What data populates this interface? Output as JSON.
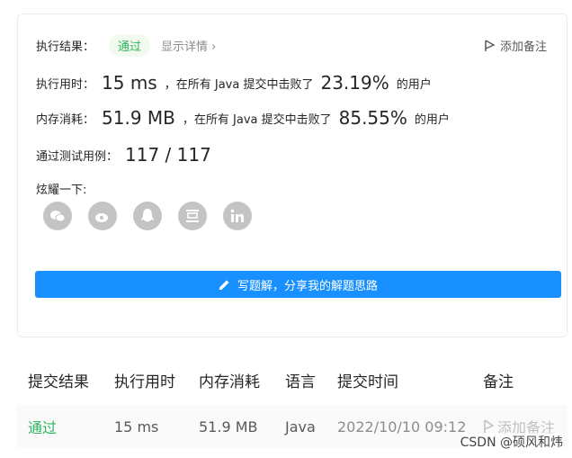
{
  "result": {
    "label": "执行结果：",
    "status": "通过",
    "detail": "显示详情 ›",
    "note": "添加备注"
  },
  "runtime": {
    "label": "执行用时：",
    "value": "15 ms",
    "mid": "，在所有 Java 提交中击败了",
    "percent": "23.19%",
    "suffix": "的用户"
  },
  "memory": {
    "label": "内存消耗：",
    "value": "51.9 MB",
    "mid": "，在所有 Java 提交中击败了",
    "percent": "85.55%",
    "suffix": "的用户"
  },
  "tests": {
    "label": "通过测试用例：",
    "value": "117 / 117"
  },
  "share": {
    "label": "炫耀一下:",
    "icons": [
      "wechat-icon",
      "weibo-icon",
      "qq-icon",
      "douban-icon",
      "linkedin-icon"
    ]
  },
  "solution_button": "写题解，分享我的解题思路",
  "table": {
    "headers": [
      "提交结果",
      "执行用时",
      "内存消耗",
      "语言",
      "提交时间",
      "备注"
    ],
    "row": {
      "status": "通过",
      "runtime": "15 ms",
      "memory": "51.9 MB",
      "language": "Java",
      "time": "2022/10/10 09:12",
      "note": "添加备注"
    }
  },
  "watermark": "CSDN @硕风和炜",
  "colors": {
    "accent": "#1890ff",
    "success": "#2db55d",
    "icon_gray": "#c4c4c4"
  }
}
